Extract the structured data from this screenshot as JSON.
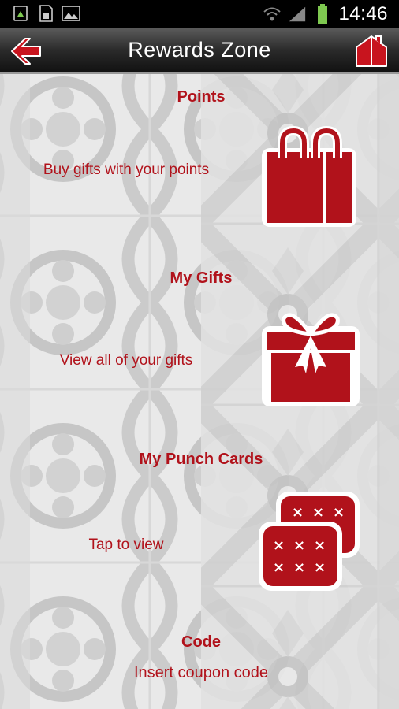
{
  "status_bar": {
    "time": "14:46",
    "icons": [
      "sync-icon",
      "sd-card-icon",
      "image-icon",
      "wifi-icon",
      "signal-icon",
      "battery-icon"
    ]
  },
  "header": {
    "title": "Rewards Zone",
    "back_icon": "back-arrow-icon",
    "home_icon": "home-icon"
  },
  "sections": [
    {
      "title": "Points",
      "description": "Buy gifts with your points",
      "icon": "shopping-bag-icon"
    },
    {
      "title": "My Gifts",
      "description": "View all of your gifts",
      "icon": "gift-box-icon"
    },
    {
      "title": "My Punch Cards",
      "description": "Tap to view",
      "icon": "punch-cards-icon"
    },
    {
      "title": "Code",
      "description": "Insert coupon code"
    }
  ],
  "colors": {
    "accent": "#b1121b",
    "header_dark": "#1a1a1a"
  }
}
